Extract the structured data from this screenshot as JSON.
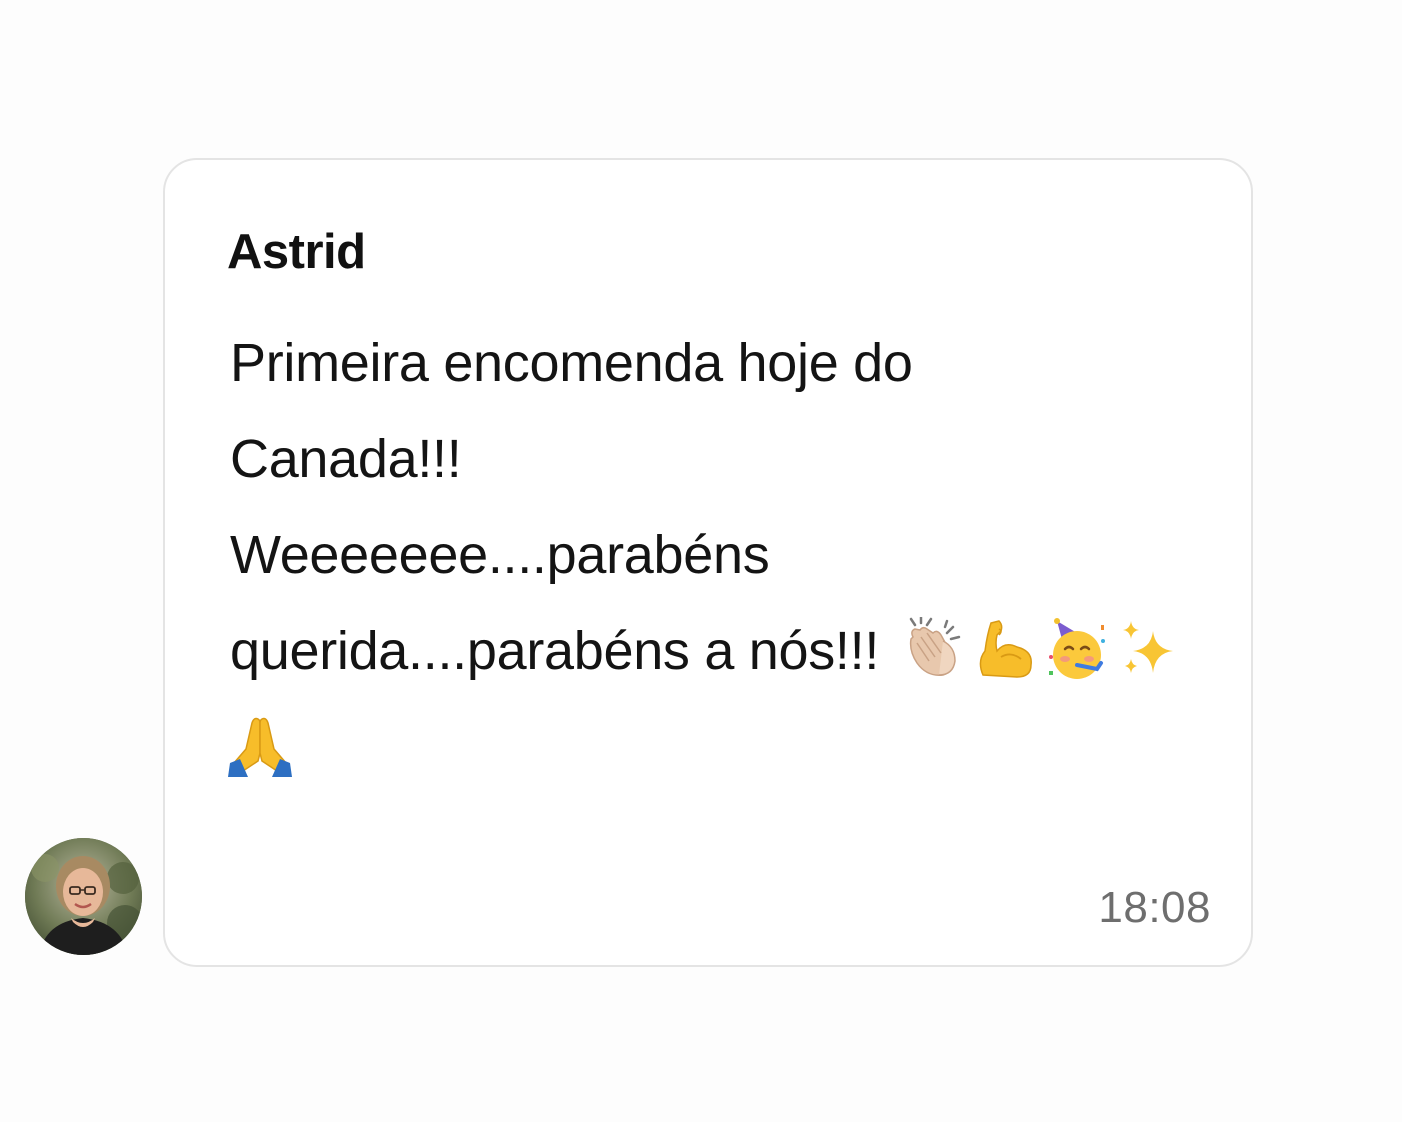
{
  "message": {
    "sender": "Astrid",
    "lines": [
      "Primeira encomenda hoje do",
      "Canada!!!",
      "Weeeeeee....parabéns",
      "querida....parabéns a nós!!!"
    ],
    "emojis": [
      {
        "name": "clapping-hands-icon",
        "char": "👏🏻"
      },
      {
        "name": "flexed-biceps-icon",
        "char": "💪"
      },
      {
        "name": "partying-face-icon",
        "char": "🥳"
      },
      {
        "name": "sparkles-icon",
        "char": "✨"
      },
      {
        "name": "folded-hands-icon",
        "char": "🙏"
      }
    ],
    "time": "18:08"
  },
  "colors": {
    "background": "#fdfdfd",
    "bubble": "#ffffff",
    "bubble_border": "#e4e4e4",
    "text": "#141414",
    "timestamp": "#6e6e6e"
  }
}
